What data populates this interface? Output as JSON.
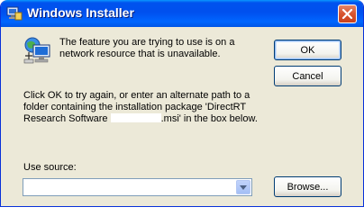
{
  "window": {
    "title": "Windows Installer",
    "close_icon": "close-icon",
    "app_icon": "installer-icon"
  },
  "dialog": {
    "message": "The feature you are trying to use is on a network resource that is unavailable.",
    "message_icon": "network-computer-icon",
    "detail_before": "Click OK to try again, or enter an alternate path to a folder containing the installation package 'DirectRT Research Software ",
    "detail_after": ".msi' in the box below.",
    "source_label": "Use source:",
    "source_value": "",
    "dropdown_icon": "chevron-down-icon"
  },
  "buttons": {
    "ok": "OK",
    "cancel": "Cancel",
    "browse": "Browse..."
  },
  "colors": {
    "titlebar": "#0054e3",
    "face": "#ece9d8",
    "close": "#d7542f"
  }
}
